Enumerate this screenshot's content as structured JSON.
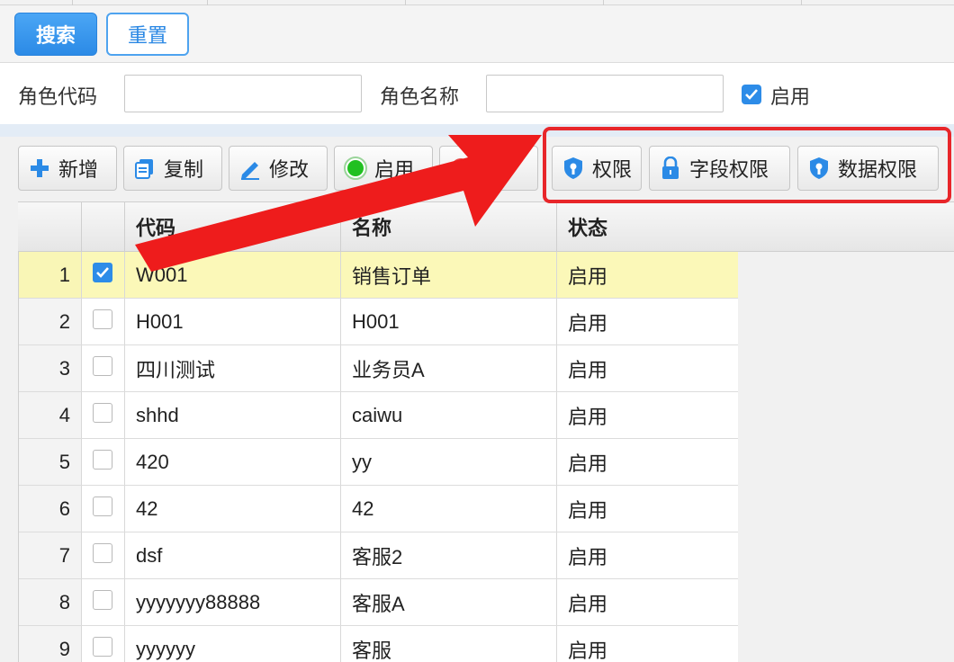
{
  "search": {
    "search_label": "搜索",
    "reset_label": "重置"
  },
  "filter": {
    "role_code_label": "角色代码",
    "role_code_value": "",
    "role_name_label": "角色名称",
    "role_name_value": "",
    "enable_label": "启用",
    "enable_checked": true
  },
  "toolbar": {
    "buttons": [
      {
        "label": "新增",
        "icon": "plus-icon"
      },
      {
        "label": "复制",
        "icon": "copy-icon"
      },
      {
        "label": "修改",
        "icon": "pencil-icon"
      },
      {
        "label": "启用",
        "icon": "green-circle-icon"
      },
      {
        "label": "",
        "icon": "disable-icon"
      },
      {
        "label": "权限",
        "icon": "shield-key-icon"
      },
      {
        "label": "字段权限",
        "icon": "lock-icon"
      },
      {
        "label": "数据权限",
        "icon": "shield-key-icon"
      }
    ]
  },
  "grid": {
    "columns": [
      "",
      "",
      "代码",
      "名称",
      "状态"
    ],
    "rows": [
      {
        "num": "1",
        "checked": true,
        "code": "W001",
        "name": "销售订单",
        "status": "启用"
      },
      {
        "num": "2",
        "checked": false,
        "code": "H001",
        "name": "H001",
        "status": "启用"
      },
      {
        "num": "3",
        "checked": false,
        "code": "四川测试",
        "name": "业务员A",
        "status": "启用"
      },
      {
        "num": "4",
        "checked": false,
        "code": "shhd",
        "name": "caiwu",
        "status": "启用"
      },
      {
        "num": "5",
        "checked": false,
        "code": "420",
        "name": "yy",
        "status": "启用"
      },
      {
        "num": "6",
        "checked": false,
        "code": "42",
        "name": "42",
        "status": "启用"
      },
      {
        "num": "7",
        "checked": false,
        "code": "dsf",
        "name": "客服2",
        "status": "启用"
      },
      {
        "num": "8",
        "checked": false,
        "code": "yyyyyyy88888",
        "name": "客服A",
        "status": "启用"
      },
      {
        "num": "9",
        "checked": false,
        "code": "yyyyyy",
        "name": "客服",
        "status": "启用"
      }
    ]
  },
  "colors": {
    "primary": "#2b8ae6",
    "highlight": "#e8262a",
    "selected_row": "#fbf8b8"
  }
}
